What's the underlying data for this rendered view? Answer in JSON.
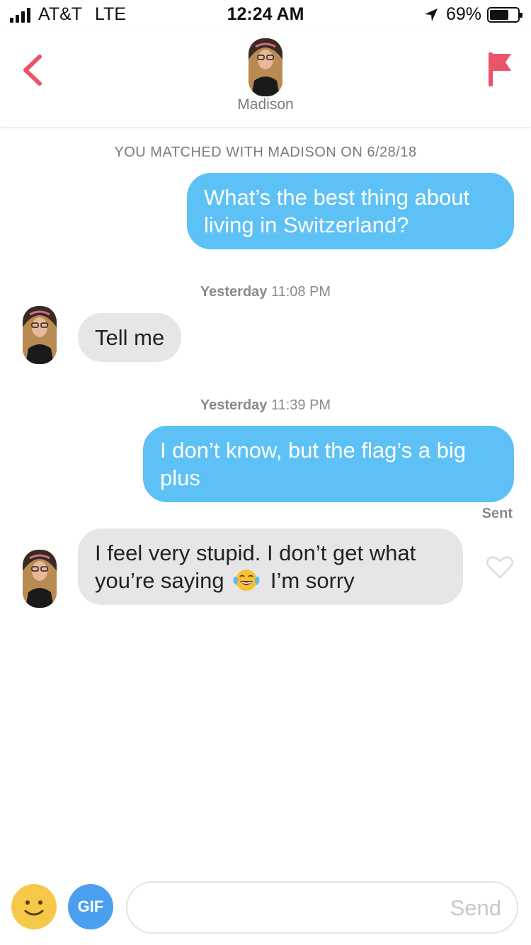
{
  "status_bar": {
    "carrier": "AT&T",
    "network": "LTE",
    "time": "12:24 AM",
    "battery": "69%",
    "battery_level": 0.69
  },
  "header": {
    "name": "Madison",
    "back_icon": "chevron-left-icon",
    "report_icon": "flag-icon",
    "accent_color": "#e9546b"
  },
  "chat": {
    "match_note": "YOU MATCHED WITH MADISON ON 6/28/18",
    "messages": [
      {
        "direction": "outgoing",
        "text": "What’s the best thing about living in Switzerland?"
      },
      {
        "timestamp_day": "Yesterday",
        "timestamp_time": "11:08 PM"
      },
      {
        "direction": "incoming",
        "text": "Tell me"
      },
      {
        "timestamp_day": "Yesterday",
        "timestamp_time": "11:39 PM"
      },
      {
        "direction": "outgoing",
        "text": "I don’t know, but the flag’s a big plus",
        "status": "Sent"
      },
      {
        "direction": "incoming",
        "text_before_emoji": "I feel very stupid. I don’t get what you’re saying",
        "emoji": "face-with-tears-of-joy-icon",
        "text_after_emoji": "I’m sorry"
      }
    ],
    "outgoing_color": "#5ec1f5",
    "incoming_color": "#e6e6e6"
  },
  "composer": {
    "emoji_icon": "smiley-icon",
    "gif_label": "GIF",
    "placeholder": "",
    "send_label": "Send"
  }
}
